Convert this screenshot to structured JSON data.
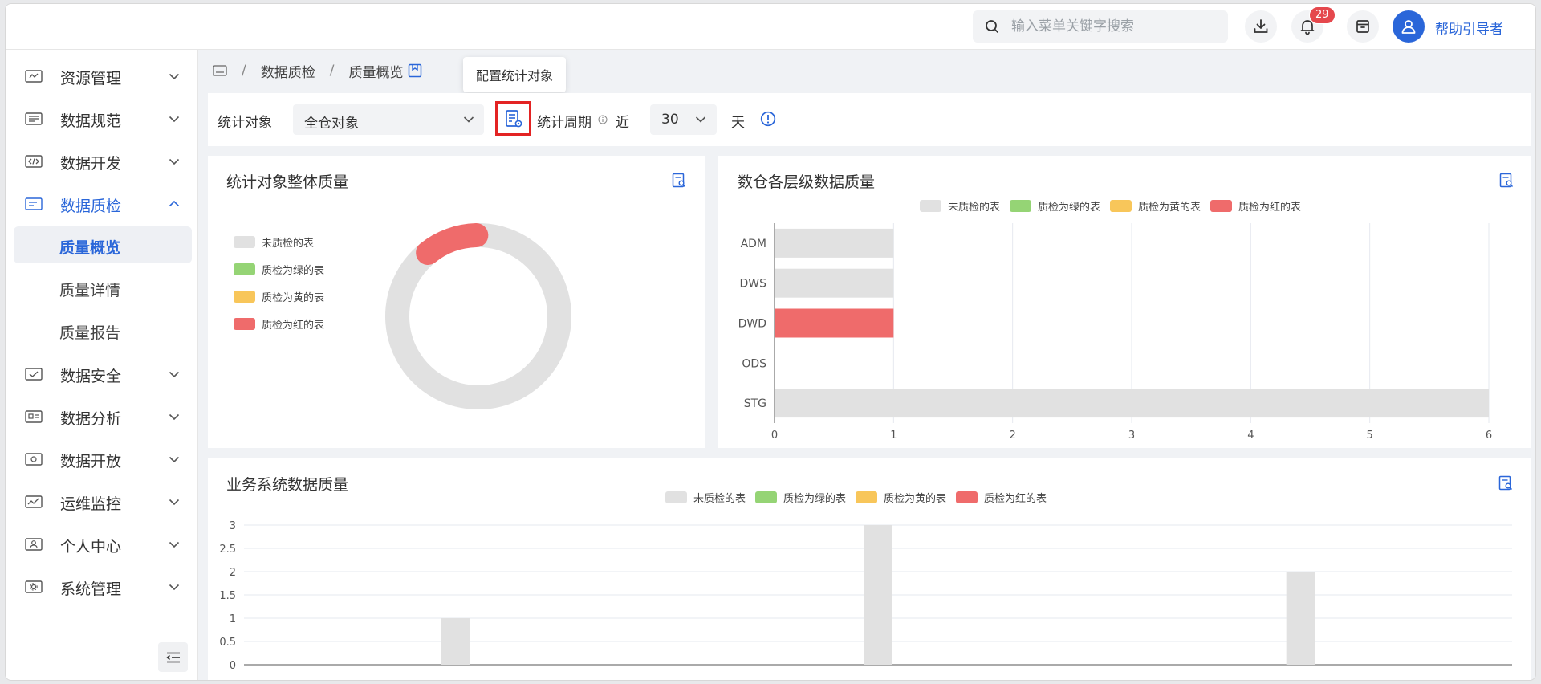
{
  "header": {
    "search_placeholder": "输入菜单关键字搜索",
    "notification_count": "29",
    "helper_label": "帮助引导者"
  },
  "sidebar": {
    "items": [
      {
        "label": "资源管理",
        "icon": "resource-icon"
      },
      {
        "label": "数据规范",
        "icon": "standard-icon"
      },
      {
        "label": "数据开发",
        "icon": "code-icon"
      },
      {
        "label": "数据质检",
        "icon": "quality-icon",
        "expanded": true
      },
      {
        "label": "数据安全",
        "icon": "security-icon"
      },
      {
        "label": "数据分析",
        "icon": "analysis-icon"
      },
      {
        "label": "数据开放",
        "icon": "open-icon"
      },
      {
        "label": "运维监控",
        "icon": "monitor-icon"
      },
      {
        "label": "个人中心",
        "icon": "user-icon"
      },
      {
        "label": "系统管理",
        "icon": "settings-icon"
      }
    ],
    "sub_items": [
      {
        "label": "质量概览",
        "active": true
      },
      {
        "label": "质量详情"
      },
      {
        "label": "质量报告"
      }
    ]
  },
  "breadcrumb": {
    "sep": "/",
    "items": [
      "数据质检",
      "质量概览"
    ]
  },
  "tooltip": "配置统计对象",
  "filters": {
    "object_label": "统计对象",
    "object_value": "全仓对象",
    "period_label": "统计周期",
    "near_label": "近",
    "days_value": "30",
    "days_unit": "天"
  },
  "legend": {
    "items": [
      {
        "label": "未质检的表",
        "color": "#e1e1e1"
      },
      {
        "label": "质检为绿的表",
        "color": "#95d475"
      },
      {
        "label": "质检为黄的表",
        "color": "#f8c65a"
      },
      {
        "label": "质检为红的表",
        "color": "#ef6b6b"
      }
    ]
  },
  "cards": {
    "overall_title": "统计对象整体质量",
    "layers_title": "数仓各层级数据质量",
    "business_title": "业务系统数据质量"
  },
  "chart_data": [
    {
      "type": "pie",
      "title": "统计对象整体质量",
      "labels": [
        "未质检的表",
        "质检为绿的表",
        "质检为黄的表",
        "质检为红的表"
      ],
      "values": [
        8,
        0,
        0,
        1
      ]
    },
    {
      "type": "bar",
      "orientation": "horizontal",
      "title": "数仓各层级数据质量",
      "categories": [
        "ADM",
        "DWS",
        "DWD",
        "ODS",
        "STG"
      ],
      "series": [
        {
          "name": "未质检的表",
          "values": [
            1,
            1,
            0,
            0,
            6
          ]
        },
        {
          "name": "质检为绿的表",
          "values": [
            0,
            0,
            0,
            0,
            0
          ]
        },
        {
          "name": "质检为黄的表",
          "values": [
            0,
            0,
            0,
            0,
            0
          ]
        },
        {
          "name": "质检为红的表",
          "values": [
            0,
            0,
            1,
            0,
            0
          ]
        }
      ],
      "xticks": [
        0,
        1,
        2,
        3,
        4,
        5,
        6
      ],
      "xlim": [
        0,
        6
      ],
      "grid": true,
      "legend": "top"
    },
    {
      "type": "bar",
      "title": "业务系统数据质量",
      "categories": [
        "",
        "",
        ""
      ],
      "series": [
        {
          "name": "未质检的表",
          "values": [
            1,
            3,
            2
          ]
        },
        {
          "name": "质检为绿的表",
          "values": [
            0,
            0,
            0
          ]
        },
        {
          "name": "质检为黄的表",
          "values": [
            0,
            0,
            0
          ]
        },
        {
          "name": "质检为红的表",
          "values": [
            0,
            0,
            0
          ]
        }
      ],
      "yticks": [
        "0",
        "0.5",
        "1",
        "1.5",
        "2",
        "2.5",
        "3"
      ],
      "ylim": [
        0,
        3
      ],
      "grid": true,
      "legend": "top"
    }
  ]
}
